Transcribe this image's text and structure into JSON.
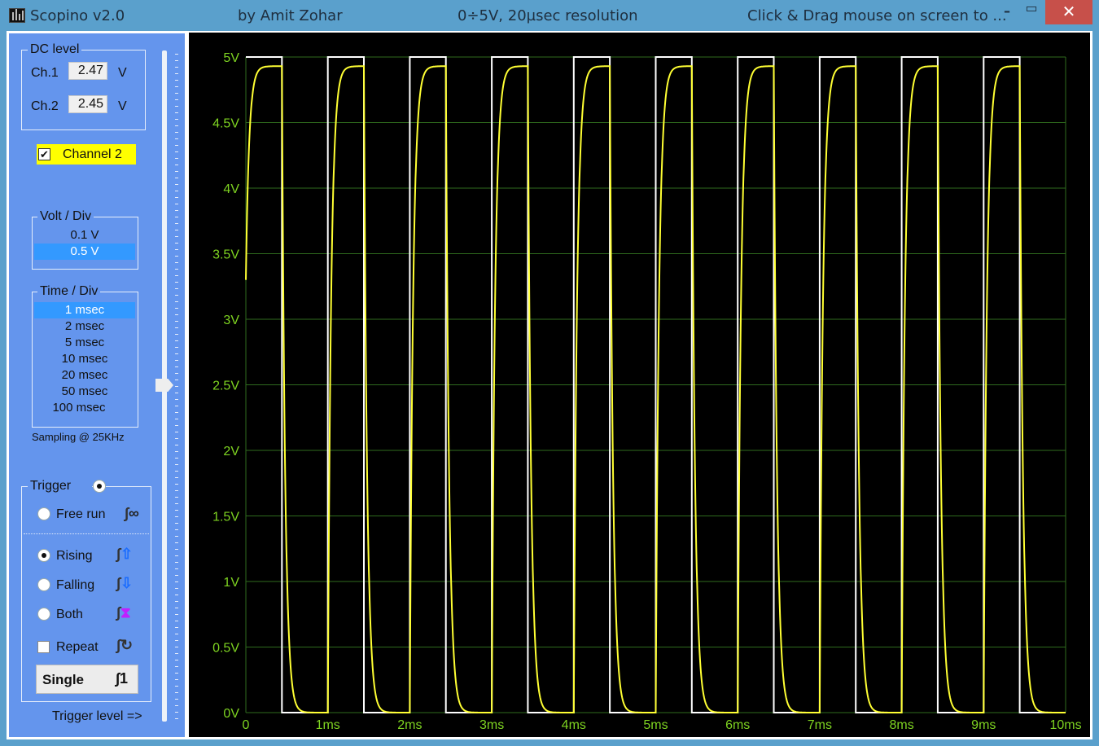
{
  "window": {
    "icon": "scope-app-icon",
    "title": "Scopino v2.0",
    "author": "by Amit Zohar",
    "range_info": "0÷5V, 20µsec resolution",
    "hint": "Click & Drag mouse on screen to ...",
    "controls": {
      "minimize": "–",
      "maximize": "▭",
      "close": "✕"
    }
  },
  "dc_level": {
    "title": "DC level",
    "ch1_label": "Ch.1",
    "ch1_value": "2.47",
    "ch1_unit": "V",
    "ch2_label": "Ch.2",
    "ch2_value": "2.45",
    "ch2_unit": "V"
  },
  "channel2": {
    "label": "Channel 2",
    "checked": true,
    "check_glyph": "✔",
    "highlight": "#ffff00"
  },
  "volt_div": {
    "title": "Volt / Div",
    "options": [
      "0.1 V",
      "0.5 V"
    ],
    "selected": "0.5 V"
  },
  "time_div": {
    "title": "Time / Div",
    "options": [
      "1 msec",
      "2 msec",
      "5 msec",
      "10 msec",
      "20 msec",
      "50 msec",
      "100 msec"
    ],
    "selected": "1 msec"
  },
  "sampling": "Sampling @ 25KHz",
  "trigger": {
    "title": "Trigger",
    "enabled": true,
    "modes": [
      {
        "label": "Free run",
        "selected": false,
        "icon": "free-run-icon",
        "glyph": "∞"
      },
      {
        "label": "Rising",
        "selected": true,
        "icon": "rising-edge-icon",
        "glyph": "⇧"
      },
      {
        "label": "Falling",
        "selected": false,
        "icon": "falling-edge-icon",
        "glyph": "⇩"
      },
      {
        "label": "Both",
        "selected": false,
        "icon": "both-edges-icon",
        "glyph": "⧗"
      }
    ],
    "repeat_label": "Repeat",
    "repeat_checked": false,
    "repeat_glyph": "↻",
    "single_label": "Single",
    "single_glyph": "1",
    "level_label": "Trigger level =>",
    "level_value_v": 2.5
  },
  "colors": {
    "panel": "#6495ed",
    "plot_bg": "#000000",
    "grid": "#2f6b1e",
    "axis_text": "#7ed321",
    "ch1": "#ffffff",
    "ch2": "#ffff33",
    "selection": "#3399ff"
  },
  "chart_data": {
    "type": "line",
    "title": "",
    "xlabel": "",
    "ylabel": "",
    "xlim": [
      0,
      10
    ],
    "ylim": [
      0,
      5
    ],
    "x_unit": "ms",
    "x_ticks": [
      "0",
      "1ms",
      "2ms",
      "3ms",
      "4ms",
      "5ms",
      "6ms",
      "7ms",
      "8ms",
      "9ms",
      "10ms"
    ],
    "y_ticks": [
      "0V",
      "0.5V",
      "1V",
      "1.5V",
      "2V",
      "2.5V",
      "3V",
      "3.5V",
      "4V",
      "4.5V",
      "5V"
    ],
    "grid": true,
    "legend": "none",
    "series": [
      {
        "name": "Ch.1 (square wave)",
        "shape": "square",
        "period_ms": 1.0,
        "rise_times_ms": [
          0.0,
          1.0,
          2.0,
          3.0,
          4.0,
          5.0,
          6.0,
          7.0,
          8.0,
          9.0
        ],
        "fall_times_ms": [
          0.44,
          1.44,
          2.44,
          3.44,
          4.44,
          5.44,
          6.44,
          7.44,
          8.44,
          9.44
        ],
        "high_v": 5.0,
        "low_v": 0.0
      },
      {
        "name": "Ch.2 (RC filtered)",
        "shape": "rc_exponential",
        "start_v": 3.3,
        "plateau_v": 4.93,
        "low_v": 0.0,
        "tau_ms": 0.04,
        "rise_start_ms": [
          0.0,
          1.0,
          2.0,
          3.0,
          4.0,
          5.0,
          6.0,
          7.0,
          8.0,
          9.0
        ],
        "fall_start_ms": [
          0.44,
          1.44,
          2.44,
          3.44,
          4.44,
          5.44,
          6.44,
          7.44,
          8.44,
          9.44
        ]
      }
    ]
  }
}
